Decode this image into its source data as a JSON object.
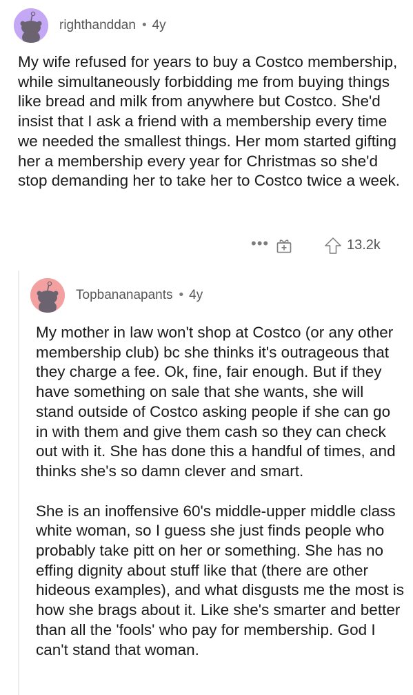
{
  "comments": [
    {
      "author": "righthanddan",
      "separator": "•",
      "age": "4y",
      "avatar_color": "#c4a7f5",
      "paragraphs": [
        "My wife refused for years to buy a Costco membership, while simultaneously forbidding me from buying things like bread and milk from anywhere but Costco. She'd insist that I ask a friend with a membership every time we needed the smallest things. Her mom started gifting her a membership every year for Christmas so she'd stop demanding her to take her to Costco twice a week."
      ],
      "actions": {
        "more_label": "•••",
        "gift_icon": "gift-icon",
        "upvote_icon": "upvote-arrow-icon",
        "score": "13.2k"
      }
    },
    {
      "author": "Topbananapants",
      "separator": "•",
      "age": "4y",
      "avatar_color": "#f2a0a0",
      "paragraphs": [
        "My mother in law won't shop at Costco (or any other membership club) bc she thinks it's outrageous that they charge a fee. Ok, fine, fair enough. But if they have something on sale that she wants, she will stand outside of Costco asking people if she can go in with them and give them cash so they can check out with it. She has done this a handful of times, and thinks she's so damn clever and smart.",
        "She is an inoffensive 60's middle-upper middle class white woman, so I guess she just finds people who probably take pitt on her or something. She has no effing dignity about stuff like that (there are other hideous examples), and what disgusts me the most is how she brags about it. Like she's smarter and better than all the 'fools' who pay for membership. God I can't stand that woman."
      ]
    }
  ]
}
